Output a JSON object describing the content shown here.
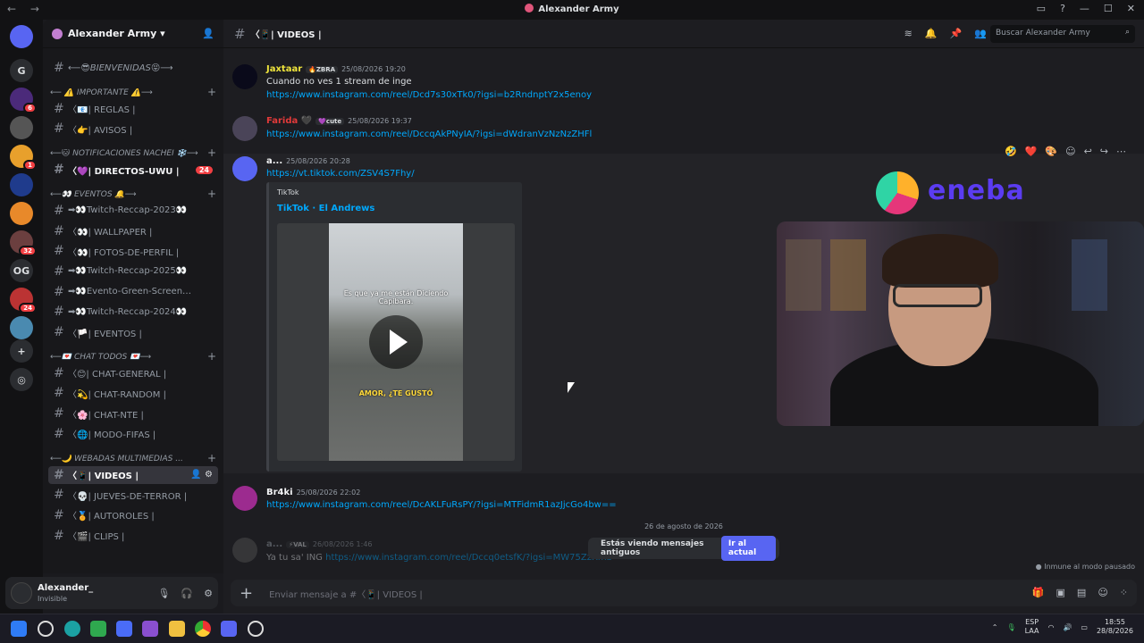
{
  "window": {
    "title": "Alexander Army",
    "nav": "← →"
  },
  "titlebar_icons": [
    "inbox-icon",
    "help-icon",
    "minimize-icon",
    "maximize-icon",
    "close-icon"
  ],
  "rail": {
    "servers": [
      {
        "name": "home",
        "label": "",
        "badge": ""
      },
      {
        "name": "G",
        "label": "G",
        "badge": ""
      },
      {
        "name": "purple-x",
        "label": "",
        "badge": "6"
      },
      {
        "name": "dark-figure",
        "label": "",
        "badge": ""
      },
      {
        "name": "emoji-server",
        "label": "",
        "badge": "1"
      },
      {
        "name": "beatles",
        "label": "",
        "badge": ""
      },
      {
        "name": "orange-face",
        "label": "",
        "badge": ""
      },
      {
        "name": "streamer",
        "label": "",
        "badge": "32"
      },
      {
        "name": "OG",
        "label": "OG",
        "badge": ""
      },
      {
        "name": "red-anime",
        "label": "",
        "badge": "24"
      },
      {
        "name": "alexander-army",
        "label": "",
        "badge": ""
      }
    ]
  },
  "sidebar": {
    "server_name": "Alexander Army",
    "channels": [
      {
        "type": "channel",
        "label": "⟵😎BIENVENIDAS😝⟶",
        "italic": true
      },
      {
        "type": "category",
        "label": "⟵ ⚠️ IMPORTANTE ⚠️⟶"
      },
      {
        "type": "channel",
        "label": "〈📧| REGLAS |"
      },
      {
        "type": "channel",
        "label": "〈👉| AVISOS |"
      },
      {
        "type": "category",
        "label": "⟵🐱 NOTIFICACIONES NACHEI ❄️⟶"
      },
      {
        "type": "channel",
        "label": "〈💜| DIRECTOS-UWU |",
        "badge": "24",
        "bold": true
      },
      {
        "type": "category",
        "label": "⟵👀 EVENTOS 🔔⟶"
      },
      {
        "type": "channel",
        "label": "➡👀Twitch-Reccap-2023👀"
      },
      {
        "type": "channel",
        "label": "〈👀| WALLPAPER |"
      },
      {
        "type": "channel",
        "label": "〈👀| FOTOS-DE-PERFIL |"
      },
      {
        "type": "channel",
        "label": "➡👀Twitch-Reccap-2025👀"
      },
      {
        "type": "channel",
        "label": "➡👀Evento-Green-Screen…"
      },
      {
        "type": "channel",
        "label": "➡👀Twitch-Reccap-2024👀"
      },
      {
        "type": "channel",
        "label": "〈🏳️| EVENTOS |"
      },
      {
        "type": "category",
        "label": "⟵💌 CHAT TODOS 💌⟶"
      },
      {
        "type": "channel",
        "label": "〈😊| CHAT-GENERAL |"
      },
      {
        "type": "channel",
        "label": "〈💫| CHAT-RANDOM |"
      },
      {
        "type": "channel",
        "label": "〈🌸| CHAT-NTE |"
      },
      {
        "type": "channel",
        "label": "〈🌐| MODO-FIFAS |"
      },
      {
        "type": "category",
        "label": "⟵🌙 WEBADAS MULTIMEDIAS ..."
      },
      {
        "type": "channel",
        "label": "〈📱| VIDEOS |",
        "active": true
      },
      {
        "type": "channel",
        "label": "〈💀| JUEVES-DE-TERROR |"
      },
      {
        "type": "channel",
        "label": "〈🏅| AUTOROLES |"
      },
      {
        "type": "channel",
        "label": "〈🎬| CLIPS |"
      }
    ]
  },
  "user": {
    "name": "Alexander_",
    "status": "Invisible"
  },
  "header": {
    "channel": "〈📱| VIDEOS |",
    "search_placeholder": "Buscar Alexander Army"
  },
  "messages": [
    {
      "author": "Jaxtaar",
      "color": "#f0e53c",
      "tag": "🔥ZBRA",
      "time": "25/08/2026 19:20",
      "text": "Cuando no ves 1 stream de inge",
      "link": "https://www.instagram.com/reel/Dcd7s30xTk0/?igsi=b2RndnptY2x5enoy"
    },
    {
      "author": "Farida 🖤",
      "color": "#e23a3a",
      "tag": "💜cute",
      "time": "25/08/2026 19:37",
      "text": "",
      "link": "https://www.instagram.com/reel/DccqAkPNyIA/?igsi=dWdranVzNzNzZHFl"
    },
    {
      "author": "a...",
      "color": "#f2f3f5",
      "tag": "",
      "time": "25/08/2026 20:28",
      "text": "",
      "link": "https://vt.tiktok.com/ZSV4S7Fhy/"
    },
    {
      "author": "Br4ki",
      "color": "#f2f3f5",
      "tag": "",
      "time": "25/08/2026 22:02",
      "text": "",
      "link": "https://www.instagram.com/reel/DcAKLFuRsPY/?igsi=MTFidmR1azJjcGo4bw=="
    },
    {
      "author": "a...",
      "color": "#949ba4",
      "tag": "⚡VAL",
      "time": "26/08/2026 1:46",
      "text": "Ya tu sa' ING",
      "link": "https://www.instagram.com/reel/Dccq0etsfK/?igsi=MW75ZzRmb"
    }
  ],
  "embed": {
    "provider": "TikTok",
    "title": "TikTok · El Andrews",
    "caption_top": "Es que ya me están Diciendo Capibara.",
    "caption_bottom": "AMOR, ¿TE GUSTÓ"
  },
  "date_divider": "26 de agosto de 2026",
  "old_messages": {
    "text": "Estás viendo mensajes antiguos",
    "button": "Ir al actual"
  },
  "immune": "Inmune al modo pausado",
  "composer": {
    "placeholder": "Enviar mensaje a #〈📱| VIDEOS |"
  },
  "overlay": {
    "brand": "eneba"
  },
  "tray": {
    "lang1": "ESP",
    "lang2": "LAA",
    "time": "18:55",
    "date": "28/8/2026"
  },
  "accent": "#5865f2"
}
